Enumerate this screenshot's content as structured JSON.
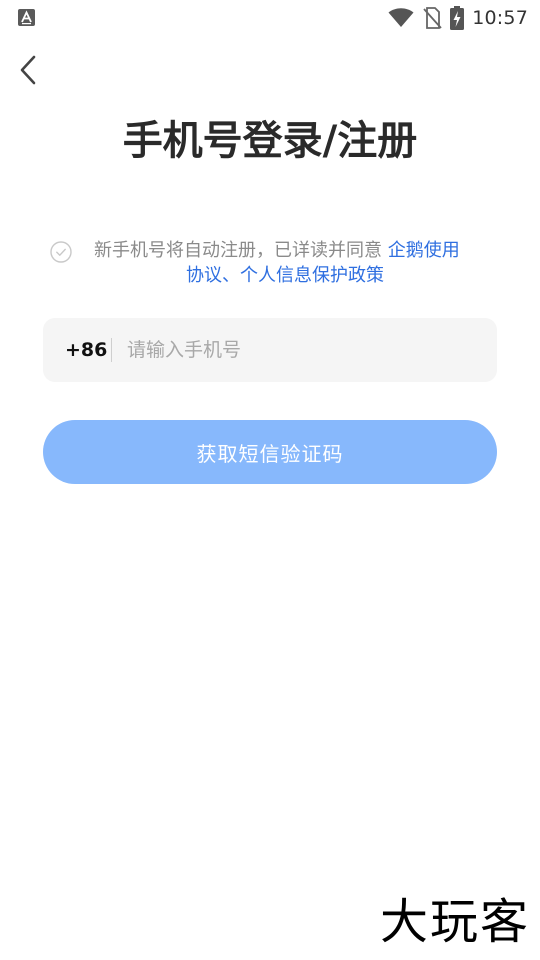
{
  "status_bar": {
    "time": "10:57",
    "icons": [
      "notification-a-icon",
      "wifi-icon",
      "no-sim-icon",
      "battery-charging-icon"
    ]
  },
  "header": {
    "back_icon": "chevron-left-icon",
    "title": "手机号登录/注册"
  },
  "agreement": {
    "checked": false,
    "text": "新手机号将自动注册，已详读并同意 ",
    "link_part1": "企鹅使用",
    "link_part2": "协议、个人信息保护政策"
  },
  "phone_form": {
    "country_code": "+86",
    "value": "",
    "placeholder": "请输入手机号"
  },
  "sms_button": {
    "label": "获取短信验证码",
    "color": "#87b8fc"
  },
  "colors": {
    "link": "#2f6fe0",
    "title": "#2a2a2a",
    "field_bg": "#f5f5f5"
  },
  "watermark": {
    "text": "大玩客"
  }
}
